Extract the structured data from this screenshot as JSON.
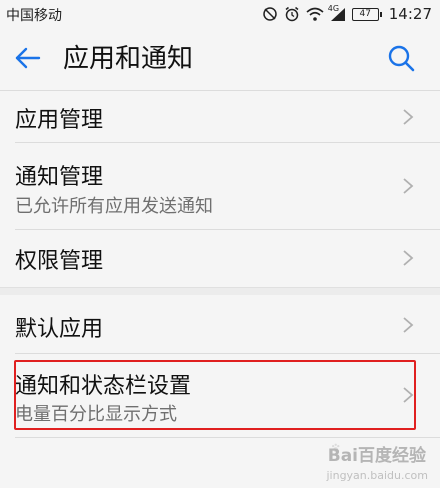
{
  "status_bar": {
    "carrier": "中国移动",
    "network": "4G",
    "battery": "47",
    "time": "14:27"
  },
  "header": {
    "title": "应用和通知"
  },
  "items": [
    {
      "title": "应用管理",
      "subtitle": ""
    },
    {
      "title": "通知管理",
      "subtitle": "已允许所有应用发送通知"
    },
    {
      "title": "权限管理",
      "subtitle": ""
    },
    {
      "title": "默认应用",
      "subtitle": ""
    },
    {
      "title": "通知和状态栏设置",
      "subtitle": "电量百分比显示方式"
    }
  ],
  "watermark": {
    "text": "Bai百度经验",
    "url": "jingyan.baidu.com"
  },
  "colors": {
    "accent": "#1a73e8",
    "highlight": "#e02020"
  }
}
